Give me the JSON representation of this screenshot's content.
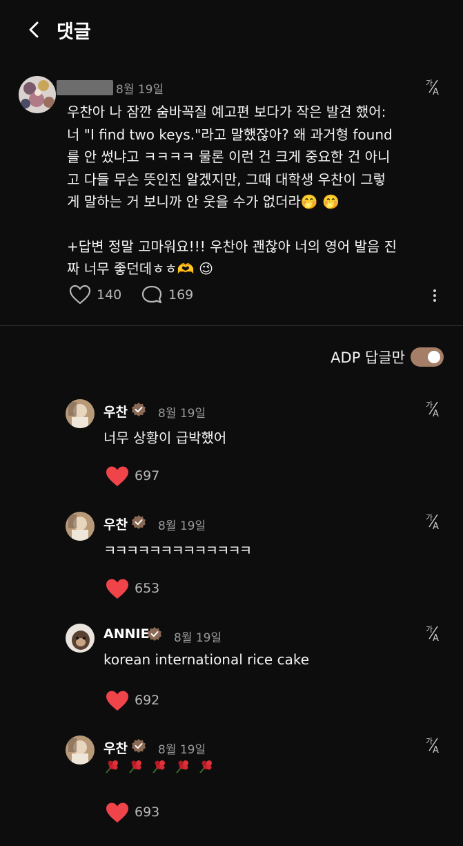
{
  "header": {
    "title": "댓글"
  },
  "post": {
    "date": "8월 19일",
    "paragraph1": "우찬아 나 잠깐 숨바꼭질 예고편 보다가 작은 발견 했어:\n너 \"I find two keys.\"라고 말했잖아? 왜 과거형 found\n를 안 썼냐고 ㅋㅋㅋㅋ 물론 이런 건 크게 중요한 건 아니\n고 다들 무슨 뜻인진 알겠지만, 그때 대학생 우찬이 그렇\n게 말하는 거 보니까 안 웃을 수가 없더라🤭 🤭",
    "paragraph2": "+답변 정말 고마워요!!! 우찬아 괜찮아 너의 영어 발음 진\n짜 너무 좋던데ㅎㅎ🫶 😉",
    "likes": "140",
    "comments": "169"
  },
  "filter": {
    "label": "ADP 답글만",
    "enabled": true
  },
  "replies": [
    {
      "name": "우찬",
      "date": "8월 19일",
      "text": "너무 상황이 급박했어",
      "likes": "697"
    },
    {
      "name": "우찬",
      "date": "8월 19일",
      "text": "ㅋㅋㅋㅋㅋㅋㅋㅋㅋㅋㅋㅋㅋ",
      "likes": "653"
    },
    {
      "name": "ANNIE",
      "date": "8월 19일",
      "text": "korean international rice cake",
      "likes": "692"
    },
    {
      "name": "우찬",
      "date": "8월 19일",
      "text": "",
      "likes": "693"
    }
  ],
  "colors": {
    "accent": "#a57e68",
    "heart": "#f0444b",
    "badge": "#8a6a55"
  },
  "icons": [
    "back-arrow-icon",
    "translate-icon",
    "heart-outline-icon",
    "comment-icon",
    "more-vertical-icon",
    "verified-badge-icon",
    "heart-filled-icon",
    "flower-emoji-icon"
  ]
}
